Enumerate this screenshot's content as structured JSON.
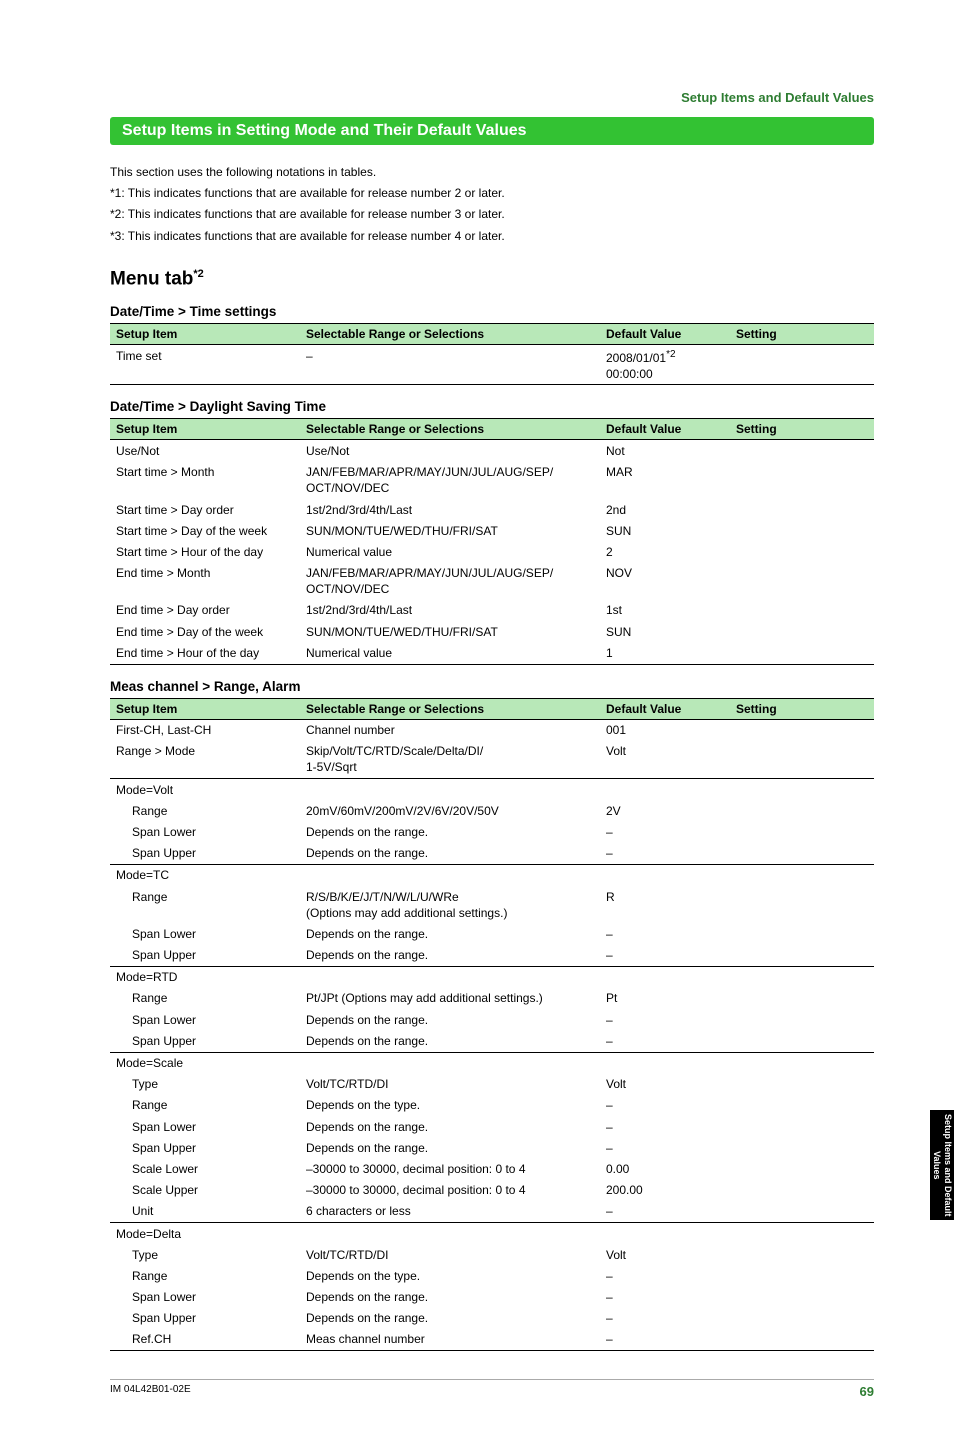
{
  "header": {
    "section_label": "Setup Items and Default Values"
  },
  "section_title": "Setup Items in Setting Mode and Their Default Values",
  "intro": {
    "line0": "This section uses the following notations in tables.",
    "line1": "*1: This indicates functions that are available for release number 2 or later.",
    "line2": "*2: This indicates functions that are available for release number 3 or later.",
    "line3": "*3: This indicates functions that are available for release number 4 or later."
  },
  "menu_heading": "Menu tab",
  "menu_heading_sup": "*2",
  "columns": {
    "item": "Setup Item",
    "sel": "Selectable Range or Selections",
    "def": "Default Value",
    "set": "Setting"
  },
  "t1": {
    "title": "Date/Time > Time settings",
    "r0": {
      "item": "Time set",
      "sel": "–",
      "def1": "2008/01/01",
      "defsup": "*2",
      "def2": "00:00:00"
    }
  },
  "t2": {
    "title": "Date/Time > Daylight Saving Time",
    "r0": {
      "item": "Use/Not",
      "sel": "Use/Not",
      "def": "Not"
    },
    "r1": {
      "item": "Start time > Month",
      "sel1": "JAN/FEB/MAR/APR/MAY/JUN/JUL/AUG/SEP/",
      "sel2": "OCT/NOV/DEC",
      "def": "MAR"
    },
    "r2": {
      "item": "Start time > Day order",
      "sel": "1st/2nd/3rd/4th/Last",
      "def": "2nd"
    },
    "r3": {
      "item": "Start time > Day of the week",
      "sel": "SUN/MON/TUE/WED/THU/FRI/SAT",
      "def": "SUN"
    },
    "r4": {
      "item": "Start time > Hour of the day",
      "sel": "Numerical value",
      "def": "2"
    },
    "r5": {
      "item": "End time > Month",
      "sel1": "JAN/FEB/MAR/APR/MAY/JUN/JUL/AUG/SEP/",
      "sel2": "OCT/NOV/DEC",
      "def": "NOV"
    },
    "r6": {
      "item": "End time > Day order",
      "sel": "1st/2nd/3rd/4th/Last",
      "def": "1st"
    },
    "r7": {
      "item": "End time > Day of the week",
      "sel": "SUN/MON/TUE/WED/THU/FRI/SAT",
      "def": "SUN"
    },
    "r8": {
      "item": "End time > Hour of the day",
      "sel": "Numerical value",
      "def": "1"
    }
  },
  "t3": {
    "title": "Meas channel > Range, Alarm",
    "r0": {
      "item": "First-CH, Last-CH",
      "sel": "Channel number",
      "def": "001"
    },
    "r1": {
      "item": "Range > Mode",
      "sel1": "Skip/Volt/TC/RTD/Scale/Delta/DI/",
      "sel2": "1-5V/Sqrt",
      "def": "Volt"
    },
    "g1": {
      "item": "Mode=Volt"
    },
    "r2": {
      "item": "Range",
      "sel": "20mV/60mV/200mV/2V/6V/20V/50V",
      "def": "2V"
    },
    "r3": {
      "item": "Span Lower",
      "sel": "Depends on the range.",
      "def": "–"
    },
    "r4": {
      "item": "Span Upper",
      "sel": "Depends on the range.",
      "def": "–"
    },
    "g2": {
      "item": "Mode=TC"
    },
    "r5": {
      "item": "Range",
      "sel1": "R/S/B/K/E/J/T/N/W/L/U/WRe",
      "sel2": "(Options may add additional settings.)",
      "def": "R"
    },
    "r6": {
      "item": "Span Lower",
      "sel": "Depends on the range.",
      "def": "–"
    },
    "r7": {
      "item": "Span Upper",
      "sel": "Depends on the range.",
      "def": "–"
    },
    "g3": {
      "item": "Mode=RTD"
    },
    "r8": {
      "item": "Range",
      "sel": "Pt/JPt (Options may add additional settings.)",
      "def": "Pt"
    },
    "r9": {
      "item": "Span Lower",
      "sel": "Depends on the range.",
      "def": "–"
    },
    "r10": {
      "item": "Span Upper",
      "sel": "Depends on the range.",
      "def": "–"
    },
    "g4": {
      "item": "Mode=Scale"
    },
    "r11": {
      "item": "Type",
      "sel": "Volt/TC/RTD/DI",
      "def": "Volt"
    },
    "r12": {
      "item": "Range",
      "sel": "Depends on the type.",
      "def": "–"
    },
    "r13": {
      "item": "Span Lower",
      "sel": "Depends on the range.",
      "def": "–"
    },
    "r14": {
      "item": "Span Upper",
      "sel": "Depends on the range.",
      "def": "–"
    },
    "r15": {
      "item": "Scale Lower",
      "sel": "–30000 to 30000, decimal position: 0 to 4",
      "def": "0.00"
    },
    "r16": {
      "item": "Scale Upper",
      "sel": "–30000 to 30000, decimal position: 0 to 4",
      "def": "200.00"
    },
    "r17": {
      "item": "Unit",
      "sel": "6 characters or less",
      "def": "–"
    },
    "g5": {
      "item": "Mode=Delta"
    },
    "r18": {
      "item": "Type",
      "sel": "Volt/TC/RTD/DI",
      "def": "Volt"
    },
    "r19": {
      "item": "Range",
      "sel": "Depends on the type.",
      "def": "–"
    },
    "r20": {
      "item": "Span Lower",
      "sel": "Depends on the range.",
      "def": "–"
    },
    "r21": {
      "item": "Span Upper",
      "sel": "Depends on the range.",
      "def": "–"
    },
    "r22": {
      "item": "Ref.CH",
      "sel": "Meas channel number",
      "def": "–"
    }
  },
  "footer": {
    "docid": "IM 04L42B01-02E",
    "page": "69"
  },
  "sidetab": "Setup Items and Default Values"
}
